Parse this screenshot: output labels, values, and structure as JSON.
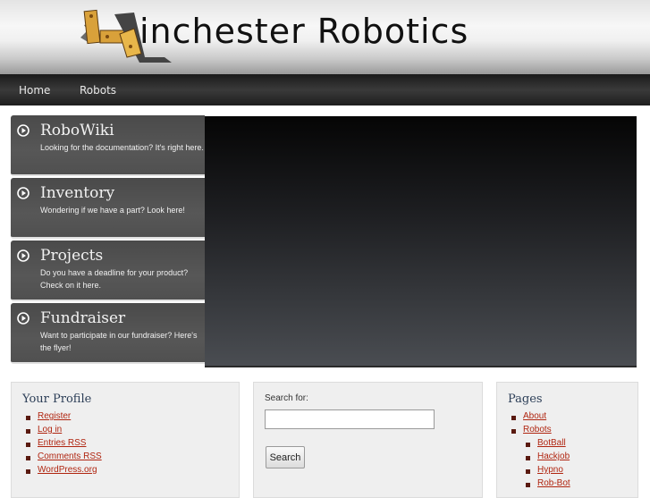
{
  "header": {
    "site_title": "inchester Robotics"
  },
  "nav": {
    "items": [
      {
        "label": "Home"
      },
      {
        "label": "Robots"
      }
    ]
  },
  "featured": {
    "items": [
      {
        "title": "RoboWiki",
        "description": "Looking for the documentation? It's right here."
      },
      {
        "title": "Inventory",
        "description": "Wondering if we have a part? Look here!"
      },
      {
        "title": "Projects",
        "description": "Do you have a deadline for your product? Check on it here."
      },
      {
        "title": "Fundraiser",
        "description": "Want to participate in our fundraiser? Here's the flyer!"
      }
    ]
  },
  "profile_widget": {
    "title": "Your Profile",
    "links": [
      "Register",
      "Log in",
      "Entries RSS",
      "Comments RSS",
      "WordPress.org"
    ]
  },
  "search_widget": {
    "label": "Search for:",
    "value": "",
    "button_label": "Search"
  },
  "pages_widget": {
    "title": "Pages",
    "links": [
      "About",
      "Robots"
    ],
    "sub_links": [
      "BotBall",
      "Hackjob",
      "Hypno",
      "Rob-Bot"
    ]
  },
  "colors": {
    "link": "#b02510",
    "widget_title": "#2c3e57"
  }
}
